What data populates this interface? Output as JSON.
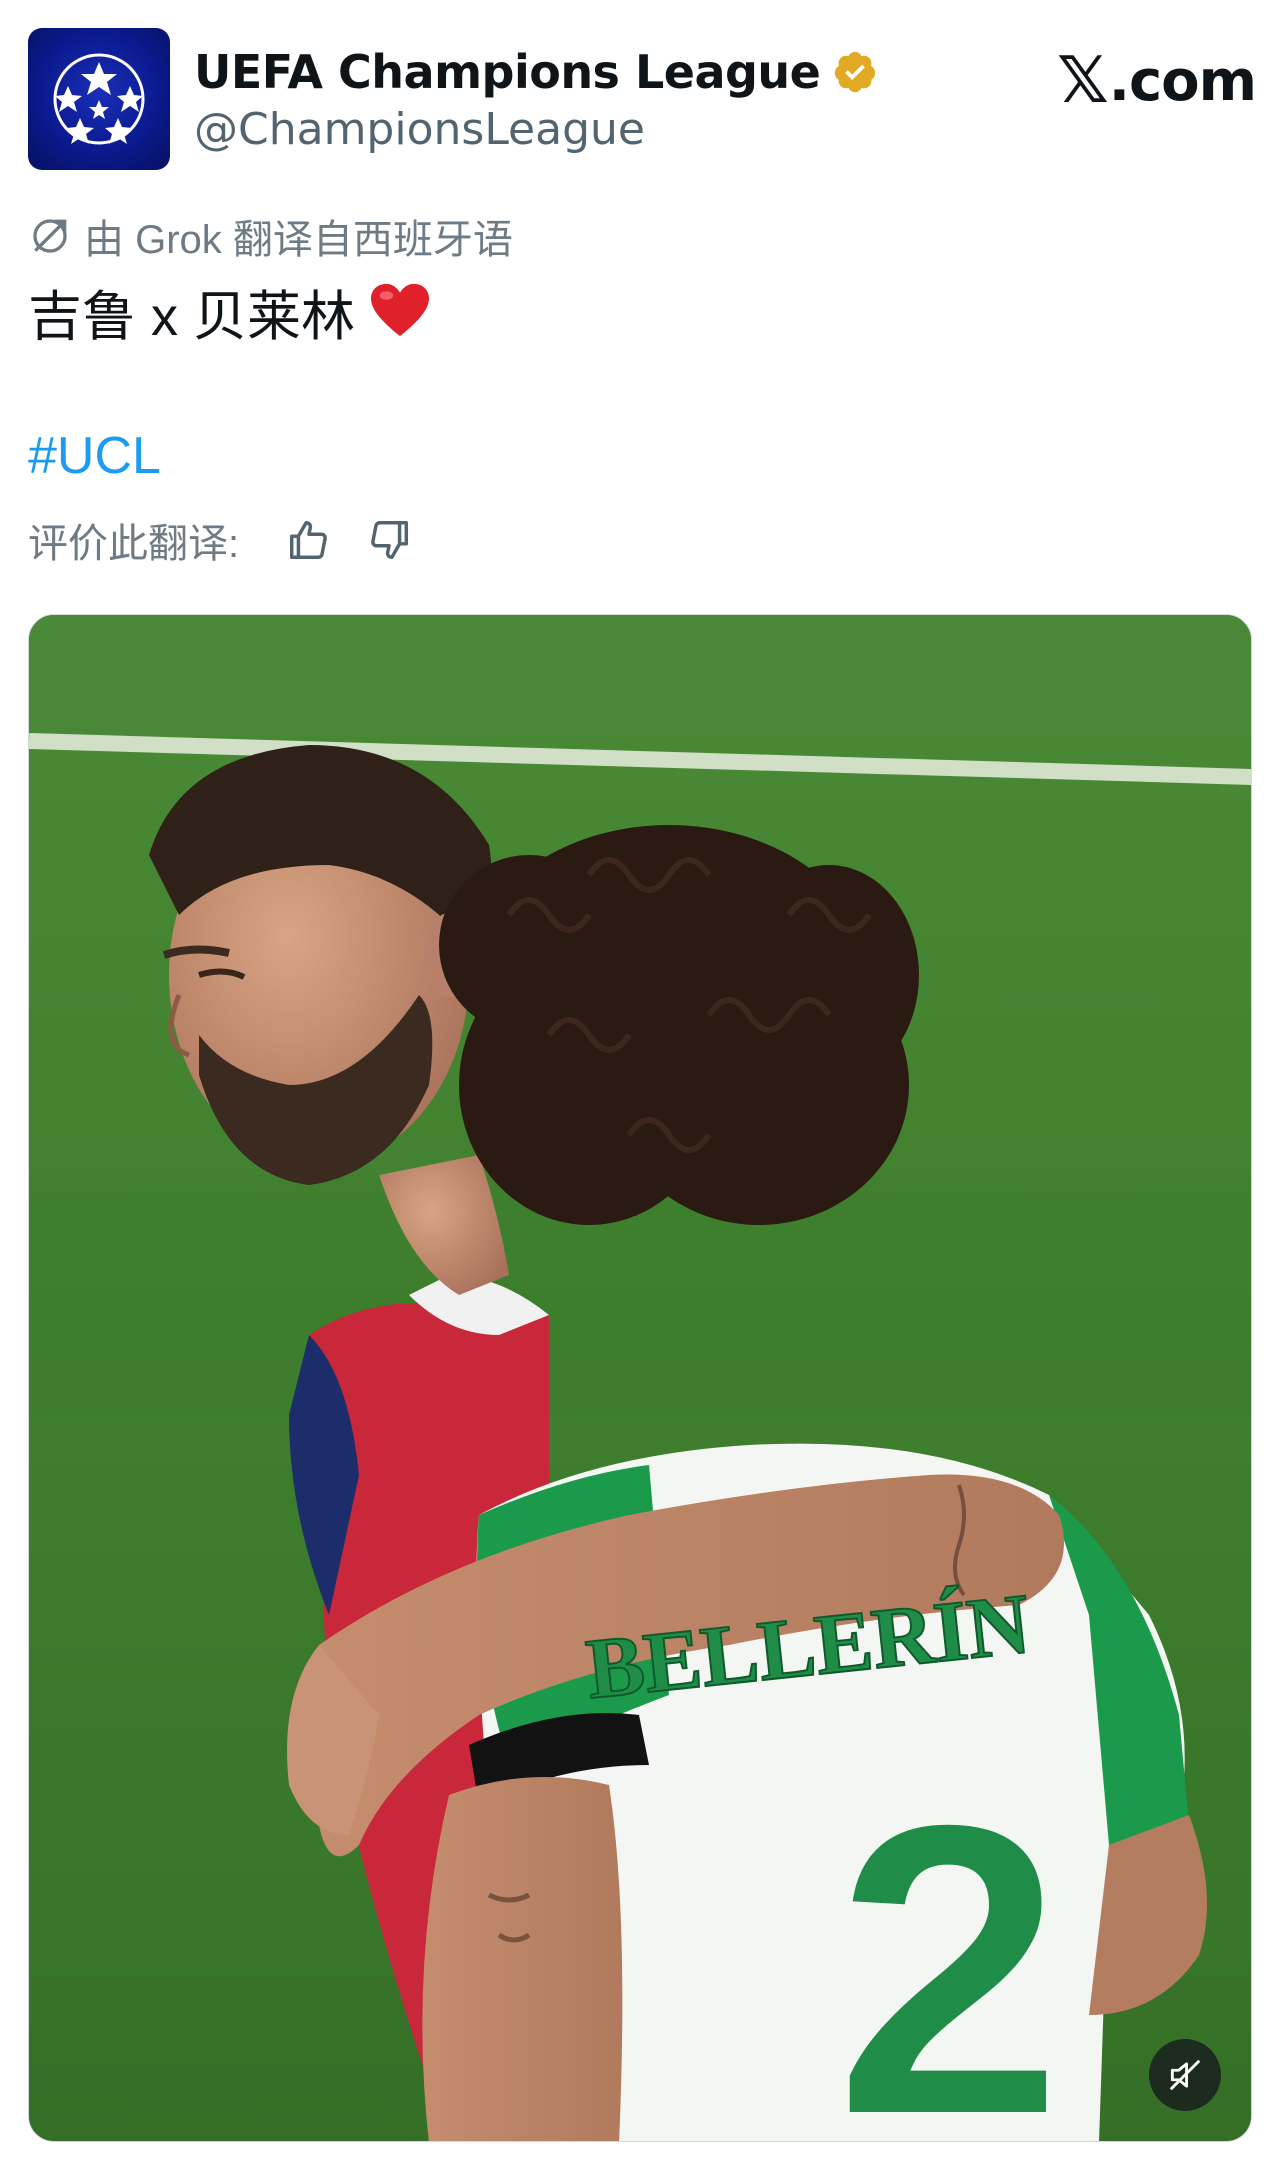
{
  "account": {
    "display_name": "UEFA Champions League",
    "handle": "@ChampionsLeague",
    "avatar_icon": "starball-logo-icon",
    "verified_icon": "verified-badge-icon",
    "verified_color": "#e2a924"
  },
  "brand": {
    "x_mark": "𝕏",
    "domain_suffix": ".com"
  },
  "translation": {
    "notice": "由 Grok 翻译自西班牙语",
    "icon": "translate-icon"
  },
  "tweet": {
    "text": "吉鲁 x 贝莱林",
    "emoji_icon": "red-heart-icon",
    "hashtag": "#UCL",
    "hashtag_color": "#1d9bf0"
  },
  "rating": {
    "label": "评价此翻译:",
    "thumbs_up_icon": "thumbs-up-icon",
    "thumbs_down_icon": "thumbs-down-icon"
  },
  "media": {
    "type": "video",
    "jersey_name": "BELLERÍN",
    "jersey_number": "2",
    "mute_icon": "speaker-muted-icon"
  }
}
